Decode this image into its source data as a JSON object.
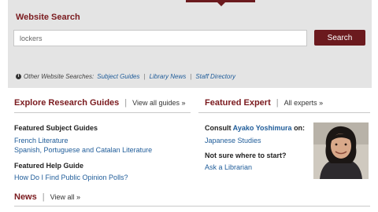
{
  "search": {
    "title": "Website Search",
    "query": "lockers",
    "button_label": "Search",
    "other_label": "Other Website Searches:",
    "other_links": [
      "Subject Guides",
      "Library News",
      "Staff Directory"
    ]
  },
  "research": {
    "title": "Explore Research Guides",
    "view_all": "View all guides »",
    "featured_subject_label": "Featured Subject Guides",
    "subject_guides": [
      "French Literature",
      "Spanish, Portuguese and Catalan Literature"
    ],
    "featured_help_label": "Featured Help Guide",
    "help_guide": "How Do I Find Public Opinion Polls?"
  },
  "expert": {
    "title": "Featured Expert",
    "view_all": "All experts »",
    "consult_prefix": "Consult",
    "name": "Ayako Yoshimura",
    "consult_suffix": "on:",
    "topic": "Japanese Studies",
    "not_sure": "Not sure where to start?",
    "ask_link": "Ask a Librarian"
  },
  "news": {
    "title": "News",
    "view_all": "View all »"
  },
  "colors": {
    "accent": "#6b1a1e",
    "heading": "#7a1a1e",
    "link": "#1f5c99",
    "panel": "#e4e4e4"
  },
  "icons": {
    "info": "info-icon"
  }
}
